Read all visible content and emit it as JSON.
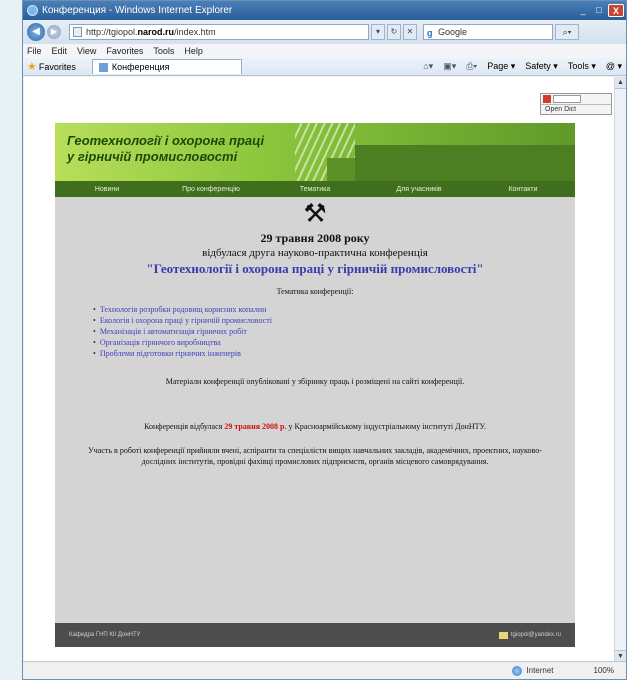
{
  "window": {
    "title": "Конференция - Windows Internet Explorer",
    "minimize": "_",
    "maximize": "□",
    "close": "X"
  },
  "address": {
    "url_prefix": "http://tgiopol.",
    "url_domain": "narod.ru",
    "url_suffix": "/index.htm",
    "search_placeholder": "Google"
  },
  "menu": {
    "items": [
      "File",
      "Edit",
      "View",
      "Favorites",
      "Tools",
      "Help"
    ]
  },
  "favorites": {
    "label": "Favorites",
    "tab_label": "Конференция",
    "commands": [
      "Page ▾",
      "Safety ▾",
      "Tools ▾",
      "@ ▾"
    ]
  },
  "dict_widget": {
    "option": "Open Dict"
  },
  "site": {
    "title_line1": "Геотехнології і охорона праці",
    "title_line2": "у гірничій промисловості",
    "nav": [
      "Новини",
      "Про конференцію",
      "Тематика",
      "Для учасників",
      "Контакти"
    ]
  },
  "content": {
    "pick_icon": "⚒",
    "date_head": "29 травня 2008 року",
    "sub_head": "відбулася друга науково-практична конференція",
    "conf_title": "\"Геотехнології і охорона праці у гірничій промисловості\"",
    "topics_head": "Тематика конференції:",
    "topics": [
      "Технологія розробки родовищ корисних копалин",
      "Екологія і охорона праці у гірничій промисловості",
      "Механізація і автоматизація гірничих робіт",
      "Організація гірничого виробництва",
      "Проблеми підготовки гірничих інженерів"
    ],
    "materials": "Матеріали конференції опубліковані у збірнику праць і розміщені на сайті конференції.",
    "held_prefix": "Конференція відбулася ",
    "held_date": "29 травня 2008 р.",
    "held_suffix": " у Красноармійському індустріальному інституті ДонНТУ.",
    "participants": "Участь в роботі конференції прийняли вчені, аспіранти та спеціалісти вищих навчальних закладів, академічних, проектних, науково-дослідних інститутів, провідні фахівці промислових підприємств, органів місцевого самоврядування."
  },
  "footer": {
    "left": "Кафедра ГНП КІІ ДонНТУ",
    "email": "tgiopol@yandex.ru"
  },
  "status": {
    "zone": "Internet",
    "zoom": "100%"
  },
  "colors": {
    "banner_green": "#8cc63c",
    "nav_dark_green": "#3f6f1c",
    "link_blue": "#4040c0",
    "accent_red": "#d01010"
  }
}
